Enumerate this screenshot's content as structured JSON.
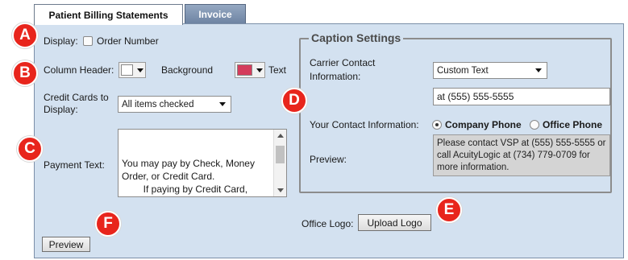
{
  "tabs": [
    {
      "label": "Patient Billing Statements",
      "active": true
    },
    {
      "label": "Invoice",
      "active": false
    }
  ],
  "display": {
    "label": "Display:",
    "order_number_label": "Order Number",
    "order_number_checked": false
  },
  "column_header": {
    "label": "Column Header:",
    "background_label": "Background",
    "background_color": "#ffffff",
    "text_label": "Text",
    "text_color": "#d43c5c"
  },
  "credit_cards": {
    "label_line1": "Credit Cards to",
    "label_line2": "Display:",
    "selected": "All items checked"
  },
  "payment_text": {
    "label": "Payment Text:",
    "value": "You may pay by Check, Money\nOrder, or Credit Card.\n        If paying by Credit Card,\nplease indicate your credit card\ndetails and sign below. If payment"
  },
  "caption_settings": {
    "legend": "Caption Settings",
    "carrier_label_line1": "Carrier Contact",
    "carrier_label_line2": "Information:",
    "carrier_selected": "Custom Text",
    "carrier_text_value": "at (555) 555-5555",
    "your_contact_label": "Your Contact Information:",
    "company_phone_label": "Company Phone",
    "office_phone_label": "Office Phone",
    "selected_option": "Company Phone",
    "preview_label": "Preview:",
    "preview_text": "Please contact VSP at (555) 555-5555 or call AcuityLogic at (734) 779-0709 for more information."
  },
  "office_logo": {
    "label": "Office Logo:",
    "upload_button": "Upload Logo"
  },
  "preview_button": "Preview",
  "callouts": [
    "A",
    "B",
    "C",
    "D",
    "E",
    "F"
  ],
  "colors": {
    "panel_bg": "#d3e1f0",
    "callout_red": "#e8251c",
    "inactive_tab": "#7a8fad"
  }
}
